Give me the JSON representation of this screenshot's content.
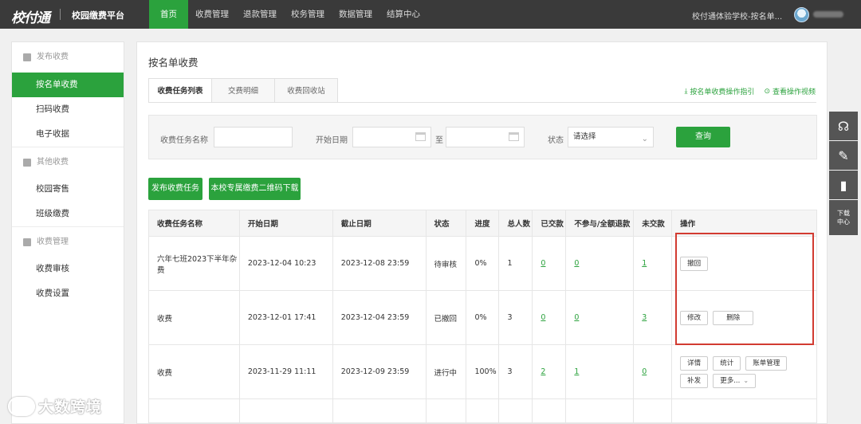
{
  "header": {
    "logo": "校付通",
    "platform": "校园缴费平台",
    "nav": [
      "首页",
      "收费管理",
      "退款管理",
      "校务管理",
      "数据管理",
      "结算中心"
    ],
    "active_nav": 0,
    "school": "校付通体验学校-按名单..."
  },
  "sidebar": {
    "groups": [
      {
        "label": "发布收费",
        "items": [
          "按名单收费",
          "扫码收费",
          "电子收据"
        ]
      },
      {
        "label": "其他收费",
        "items": [
          "校园寄售",
          "班级缴费"
        ]
      },
      {
        "label": "收费管理",
        "items": [
          "收费审核",
          "收费设置"
        ]
      }
    ],
    "active_item": "按名单收费"
  },
  "main": {
    "title": "按名单收费",
    "tabs": [
      "收费任务列表",
      "交费明细",
      "收费回收站"
    ],
    "help_links": [
      "按名单收费操作指引",
      "查看操作视频"
    ],
    "filter": {
      "name_label": "收费任务名称",
      "start_label": "开始日期",
      "to_label": "至",
      "status_label": "状态",
      "status_value": "请选择",
      "query_button": "查询"
    },
    "actions": {
      "publish": "发布收费任务",
      "qr_download": "本校专属缴费二维码下载"
    },
    "table": {
      "headers": [
        "收费任务名称",
        "开始日期",
        "截止日期",
        "状态",
        "进度",
        "总人数",
        "已交款",
        "不参与/全额退款",
        "未交款",
        "操作"
      ],
      "rows": [
        {
          "name": "六年七班2023下半年杂费",
          "start": "2023-12-04 10:23",
          "end": "2023-12-08 23:59",
          "status": "待审核",
          "progress": "0%",
          "total": "1",
          "paid": "0",
          "refund": "0",
          "unpaid": "1",
          "ops": [
            "撤回"
          ]
        },
        {
          "name": "收费",
          "start": "2023-12-01 17:41",
          "end": "2023-12-04 23:59",
          "status": "已撤回",
          "progress": "0%",
          "total": "3",
          "paid": "0",
          "refund": "0",
          "unpaid": "3",
          "ops": [
            "修改",
            "删除"
          ]
        },
        {
          "name": "收费",
          "start": "2023-11-29 11:11",
          "end": "2023-12-09 23:59",
          "status": "进行中",
          "progress": "100%",
          "total": "3",
          "paid": "2",
          "refund": "1",
          "unpaid": "0",
          "ops": [
            "详情",
            "统计",
            "账单管理",
            "补发",
            "更多..."
          ]
        }
      ]
    }
  },
  "right_tools": {
    "download_label_1": "下载",
    "download_label_2": "中心"
  },
  "watermark": "大数跨境",
  "colors": {
    "brand_green": "#2ba23d",
    "topbar": "#3a3a3a",
    "status_red": "#e04848",
    "highlight_box": "#d23b31"
  }
}
